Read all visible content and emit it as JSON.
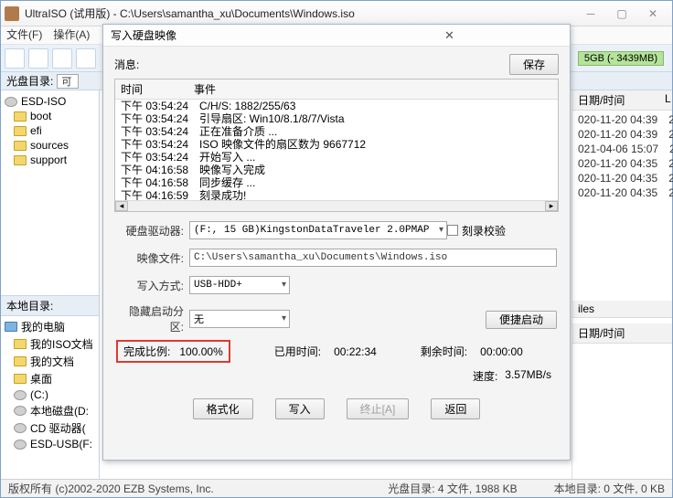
{
  "window": {
    "title": "UltraISO (试用版) - C:\\Users\\samantha_xu\\Documents\\Windows.iso"
  },
  "menubar": {
    "file": "文件(F)",
    "action": "操作(A)"
  },
  "capacity": "5GB (- 3439MB)",
  "left_panel": {
    "header": "光盘目录:",
    "header_val": "可",
    "items": [
      "ESD-ISO",
      "boot",
      "efi",
      "sources",
      "support"
    ]
  },
  "local_panel": {
    "header": "本地目录:",
    "items": [
      "我的电脑",
      "我的ISO文档",
      "我的文档",
      "桌面",
      "(C:)",
      "本地磁盘(D:",
      "CD 驱动器(",
      "ESD-USB(F:"
    ]
  },
  "right_files": {
    "hdr1": "日期/时间",
    "hdr2": "iles",
    "hdr3": "日期/时间",
    "r0": "",
    "rows": [
      "020-11-20 04:39",
      "020-11-20 04:39",
      "021-04-06 15:07",
      "020-11-20 04:35",
      "020-11-20 04:35",
      "020-11-20 04:35"
    ],
    "l_col": "L",
    "l_rows": [
      "2",
      "2",
      "2",
      "2",
      "2",
      "2"
    ]
  },
  "status": {
    "copyright": "版权所有 (c)2002-2020 EZB Systems, Inc.",
    "disc": "光盘目录: 4 文件, 1988 KB",
    "local": "本地目录: 0 文件, 0 KB"
  },
  "dialog": {
    "title": "写入硬盘映像",
    "msg_label": "消息:",
    "save": "保存",
    "log_time": "时间",
    "log_event": "事件",
    "log": [
      {
        "t": "下午 03:54:24",
        "e": "C/H/S: 1882/255/63"
      },
      {
        "t": "下午 03:54:24",
        "e": "引导扇区: Win10/8.1/8/7/Vista"
      },
      {
        "t": "下午 03:54:24",
        "e": "正在准备介质 ..."
      },
      {
        "t": "下午 03:54:24",
        "e": "ISO 映像文件的扇区数为 9667712"
      },
      {
        "t": "下午 03:54:24",
        "e": "开始写入 ..."
      },
      {
        "t": "下午 04:16:58",
        "e": "映像写入完成"
      },
      {
        "t": "下午 04:16:58",
        "e": "同步缓存 ..."
      },
      {
        "t": "下午 04:16:59",
        "e": "刻录成功!"
      }
    ],
    "drive_label": "硬盘驱动器:",
    "drive_value": "(F:, 15 GB)KingstonDataTraveler 2.0PMAP",
    "verify": "刻录校验",
    "image_label": "映像文件:",
    "image_value": "C:\\Users\\samantha_xu\\Documents\\Windows.iso",
    "method_label": "写入方式:",
    "method_value": "USB-HDD+",
    "hidden_label": "隐藏启动分区:",
    "hidden_value": "无",
    "quickboot": "便捷启动",
    "pct_label": "完成比例:",
    "pct_value": "100.00%",
    "elapsed_label": "已用时间:",
    "elapsed_value": "00:22:34",
    "remain_label": "剩余时间:",
    "remain_value": "00:00:00",
    "speed_label": "速度:",
    "speed_value": "3.57MB/s",
    "b_format": "格式化",
    "b_write": "写入",
    "b_abort": "终止[A]",
    "b_back": "返回"
  }
}
